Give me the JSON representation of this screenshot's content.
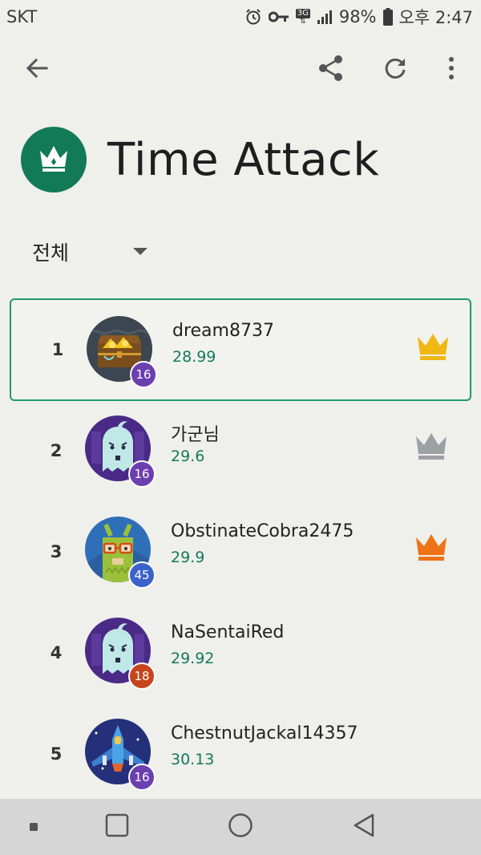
{
  "status_bar": {
    "carrier": "SKT",
    "network": "3G",
    "battery": "98%",
    "time": "오후 2:47",
    "icons": [
      "alarm-icon",
      "key-icon",
      "network-3g-icon",
      "signal-icon",
      "battery-icon"
    ]
  },
  "app_bar": {
    "icons": [
      "back-arrow-icon",
      "share-icon",
      "refresh-icon",
      "more-vert-icon"
    ]
  },
  "header": {
    "title": "Time Attack",
    "icon": "crown-icon",
    "badge_color": "#137a57"
  },
  "filter": {
    "selected": "전체"
  },
  "leaderboard": [
    {
      "rank": "1",
      "name": "dream8737",
      "score": "28.99",
      "level": "16",
      "avatar": "treasure-chest",
      "crown": "gold"
    },
    {
      "rank": "2",
      "name": "가군님",
      "score": "29.6",
      "level": "16",
      "avatar": "ghost",
      "crown": "silver"
    },
    {
      "rank": "3",
      "name": "ObstinateCobra2475",
      "score": "29.9",
      "level": "45",
      "avatar": "llama",
      "crown": "bronze"
    },
    {
      "rank": "4",
      "name": "NaSentaiRed",
      "score": "29.92",
      "level": "18",
      "avatar": "ghost",
      "crown": ""
    },
    {
      "rank": "5",
      "name": "ChestnutJackal14357",
      "score": "30.13",
      "level": "16",
      "avatar": "spaceship",
      "crown": ""
    }
  ],
  "colors": {
    "accent": "#137a57",
    "gold": "#f1b712",
    "silver": "#9da0a4",
    "bronze": "#ee7318",
    "level_purple": "#6b3fb0",
    "level_blue": "#3b62c8",
    "level_orange": "#c6451d"
  },
  "nav_bar": {
    "icons": [
      "recents-dot-icon",
      "overview-square-icon",
      "home-circle-icon",
      "back-triangle-icon"
    ]
  }
}
